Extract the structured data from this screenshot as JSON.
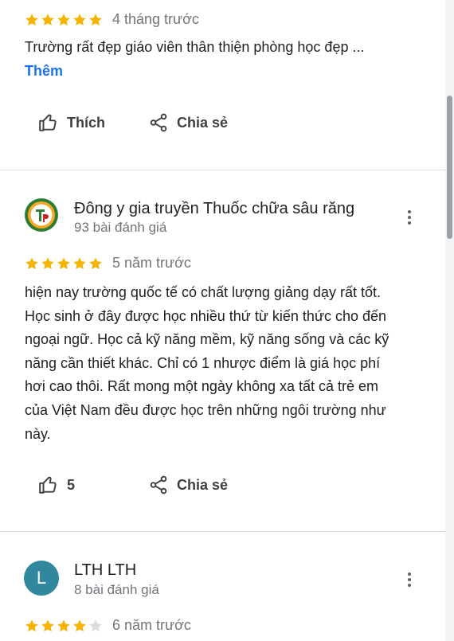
{
  "colors": {
    "star_filled": "#f4b400",
    "star_empty": "#dadce0",
    "link": "#1a73e8",
    "avatar_lth": "#31879e"
  },
  "reviews": [
    {
      "stars": 5,
      "time": "4 tháng trước",
      "text": "Trường rất đẹp giáo viên thân thiện phòng học đẹp ...",
      "more_label": "Thêm",
      "like_label": "Thích",
      "share_label": "Chia sẻ"
    },
    {
      "author": "Đông y gia truyền Thuốc chữa sâu răng",
      "meta": "93 bài đánh giá",
      "avatar_icon": "logo-tp-icon",
      "stars": 5,
      "time": "5 năm trước",
      "text_lines": [
        "hiện nay trường quốc tế có chất lượng giảng dạy rất tốt.",
        "Học sinh ở đây được học nhiều thứ từ kiến thức cho đến",
        "ngoại ngữ. Học cả kỹ năng mềm, kỹ năng sống và các kỹ",
        "năng cần thiết khác. Chỉ có 1 nhược điểm là giá học phí",
        "hơi cao thôi. Rất mong một ngày không xa tất cả trẻ em",
        "của Việt Nam đều được học trên những ngôi trường như",
        "này."
      ],
      "like_count": "5",
      "share_label": "Chia sẻ"
    },
    {
      "author": "LTH LTH",
      "meta": "8 bài đánh giá",
      "avatar_letter": "L",
      "stars": 4,
      "time": "6 năm trước"
    }
  ]
}
